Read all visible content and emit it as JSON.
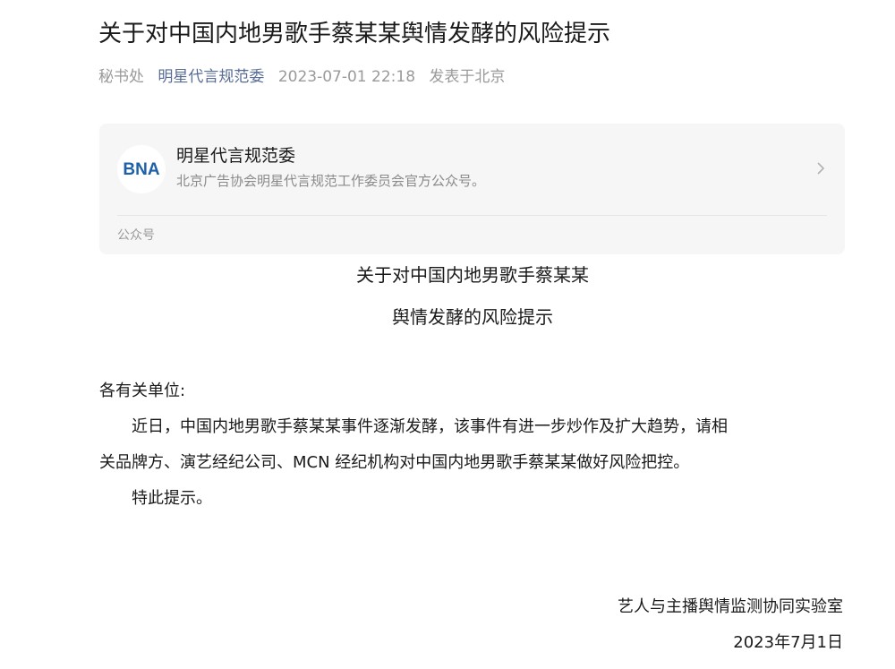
{
  "article": {
    "title": "关于对中国内地男歌手蔡某某舆情发酵的风险提示",
    "author": "秘书处",
    "account_link": "明星代言规范委",
    "datetime": "2023-07-01 22:18",
    "location": "发表于北京"
  },
  "account_card": {
    "logo_text": "BNA",
    "name": "明星代言规范委",
    "description": "北京广告协会明星代言规范工作委员会官方公众号。",
    "type_label": "公众号",
    "chevron_icon": "chevron-right-icon"
  },
  "document": {
    "heading_line1": "关于对中国内地男歌手蔡某某",
    "heading_line2": "舆情发酵的风险提示",
    "salutation": "各有关单位:",
    "paragraph_line1": "　　近日，中国内地男歌手蔡某某事件逐渐发酵，该事件有进一步炒作及扩大趋势，请相",
    "paragraph_line2": "关品牌方、演艺经纪公司、MCN 经纪机构对中国内地男歌手蔡某某做好风险把控。",
    "closing": "　　特此提示。",
    "signature_org": "艺人与主播舆情监测协同实验室",
    "signature_date": "2023年7月1日"
  },
  "colors": {
    "link": "#576b95",
    "logo_blue": "#1d5fa8"
  }
}
